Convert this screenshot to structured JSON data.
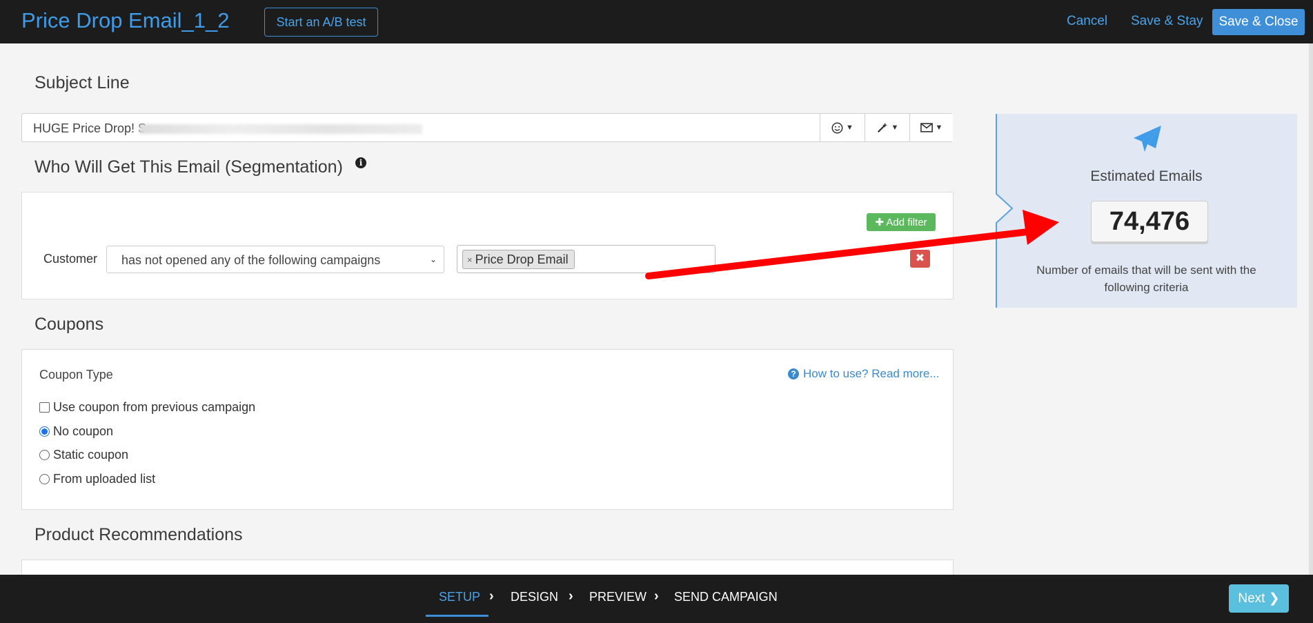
{
  "header": {
    "title": "Price Drop Email_1_2",
    "ab_test_label": "Start an A/B test",
    "cancel_label": "Cancel",
    "save_stay_label": "Save & Stay",
    "save_close_label": "Save & Close"
  },
  "subject": {
    "heading": "Subject Line",
    "value": "HUGE Price Drop! S",
    "emoji_icon": "smiley-icon",
    "magic_icon": "magic-wand-icon",
    "mail_icon": "envelope-icon"
  },
  "segmentation": {
    "heading": "Who Will Get This Email (Segmentation)",
    "info_icon": "info-icon",
    "add_filter_label": "Add filter",
    "customer_label": "Customer",
    "condition_value": "has not opened any of the following campaigns",
    "campaign_tag": "Price Drop Email",
    "remove_icon": "close-icon"
  },
  "coupons": {
    "heading": "Coupons",
    "type_label": "Coupon Type",
    "help_link": "How to use? Read more...",
    "use_previous_label": "Use coupon from previous campaign",
    "use_previous_checked": false,
    "options": [
      {
        "label": "No coupon",
        "selected": true
      },
      {
        "label": "Static coupon",
        "selected": false
      },
      {
        "label": "From uploaded list",
        "selected": false
      }
    ]
  },
  "recommendations": {
    "heading": "Product Recommendations"
  },
  "estimate": {
    "icon": "paper-plane-icon",
    "title": "Estimated Emails",
    "count": "74,476",
    "description": "Number of emails that will be sent with the following criteria"
  },
  "footer": {
    "steps": [
      "SETUP",
      "DESIGN",
      "PREVIEW",
      "SEND CAMPAIGN"
    ],
    "active_step": "SETUP",
    "next_label": "Next"
  },
  "colors": {
    "accent": "#3f8fd8",
    "success": "#5cb85c",
    "danger": "#d9534f",
    "annotation_arrow": "#ff0000"
  }
}
